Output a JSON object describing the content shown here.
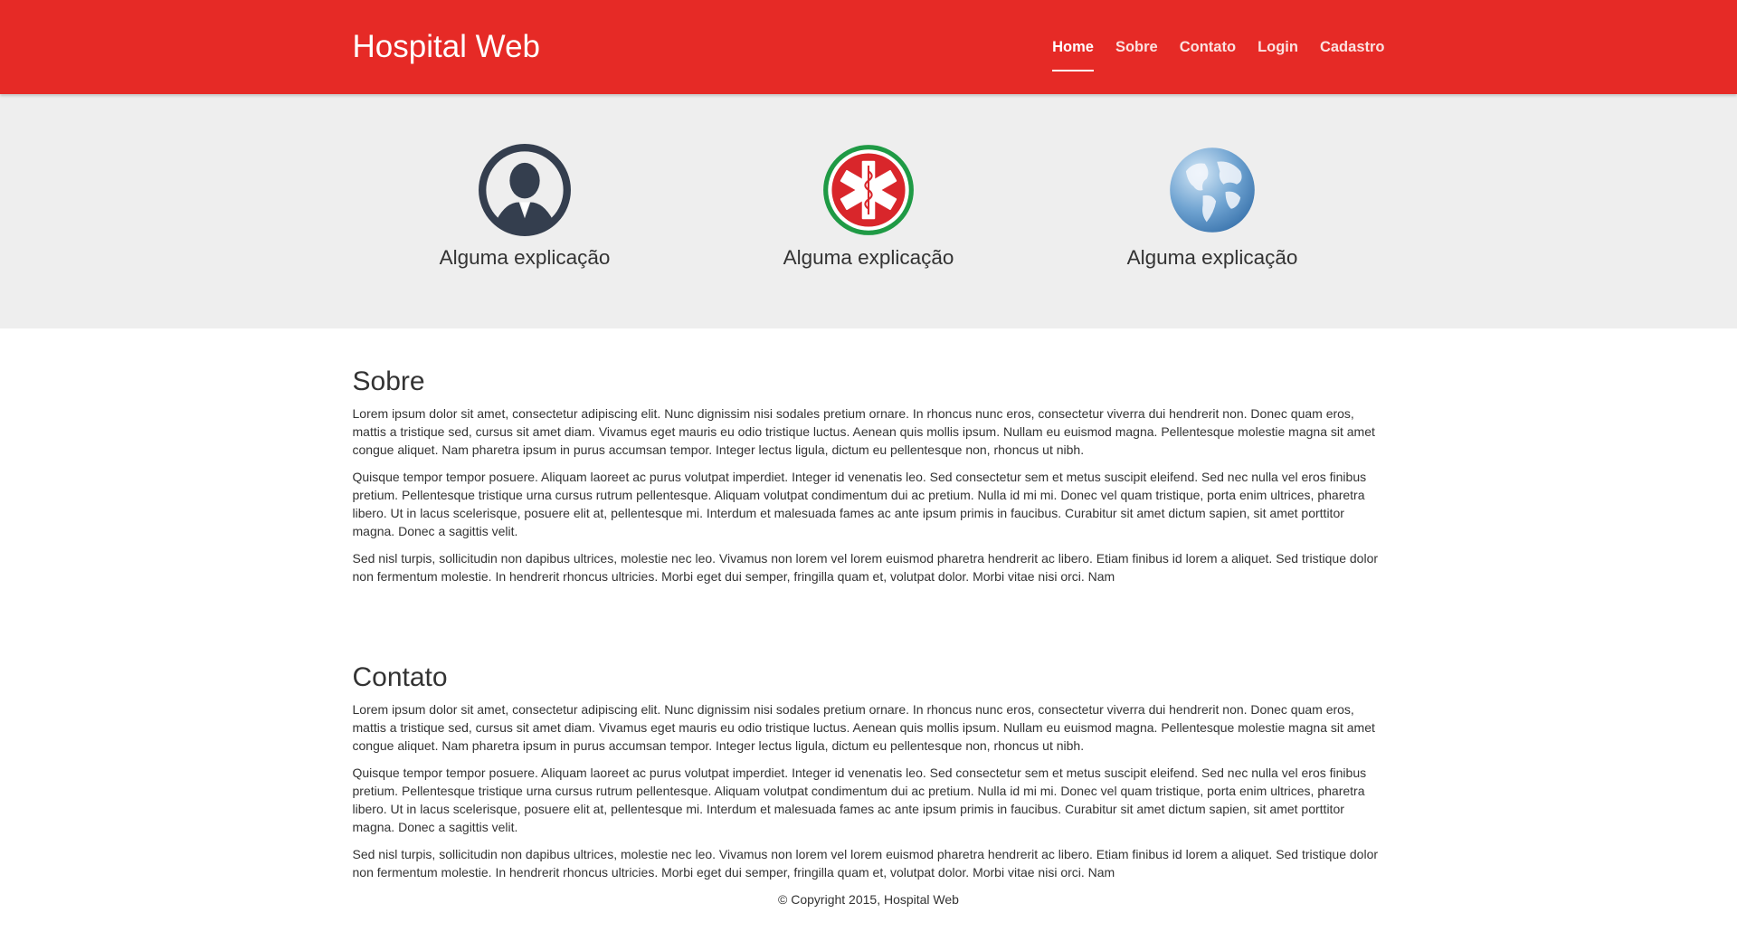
{
  "brand": {
    "title": "Hospital Web",
    "color": "#e62a26"
  },
  "nav": {
    "items": [
      {
        "label": "Home",
        "active": true
      },
      {
        "label": "Sobre"
      },
      {
        "label": "Contato"
      },
      {
        "label": "Login"
      },
      {
        "label": "Cadastro"
      }
    ]
  },
  "features": [
    {
      "icon": "user-icon",
      "caption": "Alguma explicação"
    },
    {
      "icon": "medical-star-of-life-icon",
      "caption": "Alguma explicação"
    },
    {
      "icon": "globe-icon",
      "caption": "Alguma explicação"
    }
  ],
  "sobre": {
    "title": "Sobre",
    "paragraphs": [
      "Lorem ipsum dolor sit amet, consectetur adipiscing elit. Nunc dignissim nisi sodales pretium ornare. In rhoncus nunc eros, consectetur viverra dui hendrerit non. Donec quam eros, mattis a tristique sed, cursus sit amet diam. Vivamus eget mauris eu odio tristique luctus. Aenean quis mollis ipsum. Nullam eu euismod magna. Pellentesque molestie magna sit amet congue aliquet. Nam pharetra ipsum in purus accumsan tempor. Integer lectus ligula, dictum eu pellentesque non, rhoncus ut nibh.",
      "Quisque tempor tempor posuere. Aliquam laoreet ac purus volutpat imperdiet. Integer id venenatis leo. Sed consectetur sem et metus suscipit eleifend. Sed nec nulla vel eros finibus pretium. Pellentesque tristique urna cursus rutrum pellentesque. Aliquam volutpat condimentum dui ac pretium. Nulla id mi mi. Donec vel quam tristique, porta enim ultrices, pharetra libero. Ut in lacus scelerisque, posuere elit at, pellentesque mi. Interdum et malesuada fames ac ante ipsum primis in faucibus. Curabitur sit amet dictum sapien, sit amet porttitor magna. Donec a sagittis velit.",
      "Sed nisl turpis, sollicitudin non dapibus ultrices, molestie nec leo. Vivamus non lorem vel lorem euismod pharetra hendrerit ac libero. Etiam finibus id lorem a aliquet. Sed tristique dolor non fermentum molestie. In hendrerit rhoncus ultricies. Morbi eget dui semper, fringilla quam et, volutpat dolor. Morbi vitae nisi orci. Nam"
    ]
  },
  "contato": {
    "title": "Contato",
    "paragraphs": [
      "Lorem ipsum dolor sit amet, consectetur adipiscing elit. Nunc dignissim nisi sodales pretium ornare. In rhoncus nunc eros, consectetur viverra dui hendrerit non. Donec quam eros, mattis a tristique sed, cursus sit amet diam. Vivamus eget mauris eu odio tristique luctus. Aenean quis mollis ipsum. Nullam eu euismod magna. Pellentesque molestie magna sit amet congue aliquet. Nam pharetra ipsum in purus accumsan tempor. Integer lectus ligula, dictum eu pellentesque non, rhoncus ut nibh.",
      "Quisque tempor tempor posuere. Aliquam laoreet ac purus volutpat imperdiet. Integer id venenatis leo. Sed consectetur sem et metus suscipit eleifend. Sed nec nulla vel eros finibus pretium. Pellentesque tristique urna cursus rutrum pellentesque. Aliquam volutpat condimentum dui ac pretium. Nulla id mi mi. Donec vel quam tristique, porta enim ultrices, pharetra libero. Ut in lacus scelerisque, posuere elit at, pellentesque mi. Interdum et malesuada fames ac ante ipsum primis in faucibus. Curabitur sit amet dictum sapien, sit amet porttitor magna. Donec a sagittis velit.",
      "Sed nisl turpis, sollicitudin non dapibus ultrices, molestie nec leo. Vivamus non lorem vel lorem euismod pharetra hendrerit ac libero. Etiam finibus id lorem a aliquet. Sed tristique dolor non fermentum molestie. In hendrerit rhoncus ultricies. Morbi eget dui semper, fringilla quam et, volutpat dolor. Morbi vitae nisi orci. Nam"
    ]
  },
  "footer": {
    "text": "© Copyright 2015, Hospital Web"
  }
}
